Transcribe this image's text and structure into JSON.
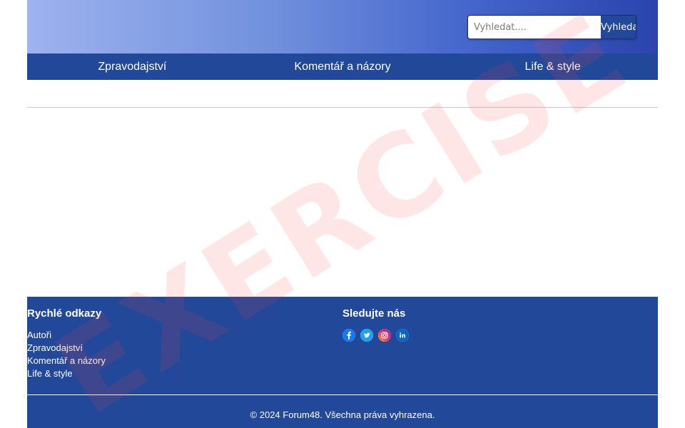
{
  "search": {
    "placeholder": "Vyhledat....",
    "button_label": "Vyhledat"
  },
  "nav": {
    "items": [
      {
        "label": "Zpravodajství"
      },
      {
        "label": "Komentář a názory"
      },
      {
        "label": "Life & style"
      }
    ]
  },
  "footer": {
    "quick_links": {
      "title": "Rychlé odkazy",
      "items": [
        "Autoři",
        "Zpravodajství",
        "Komentář a názory",
        "Life & style"
      ]
    },
    "social": {
      "title": "Sledujte nás",
      "icons": [
        "facebook-icon",
        "twitter-icon",
        "instagram-icon",
        "linkedin-icon"
      ]
    },
    "copyright": "© 2024 Forum48. Všechna práva vyhrazena."
  },
  "watermark": "EXERCISE",
  "colors": {
    "nav_bg": "#224899",
    "footer_bg": "#224899",
    "header_gradient_end": "#2a44ad"
  }
}
